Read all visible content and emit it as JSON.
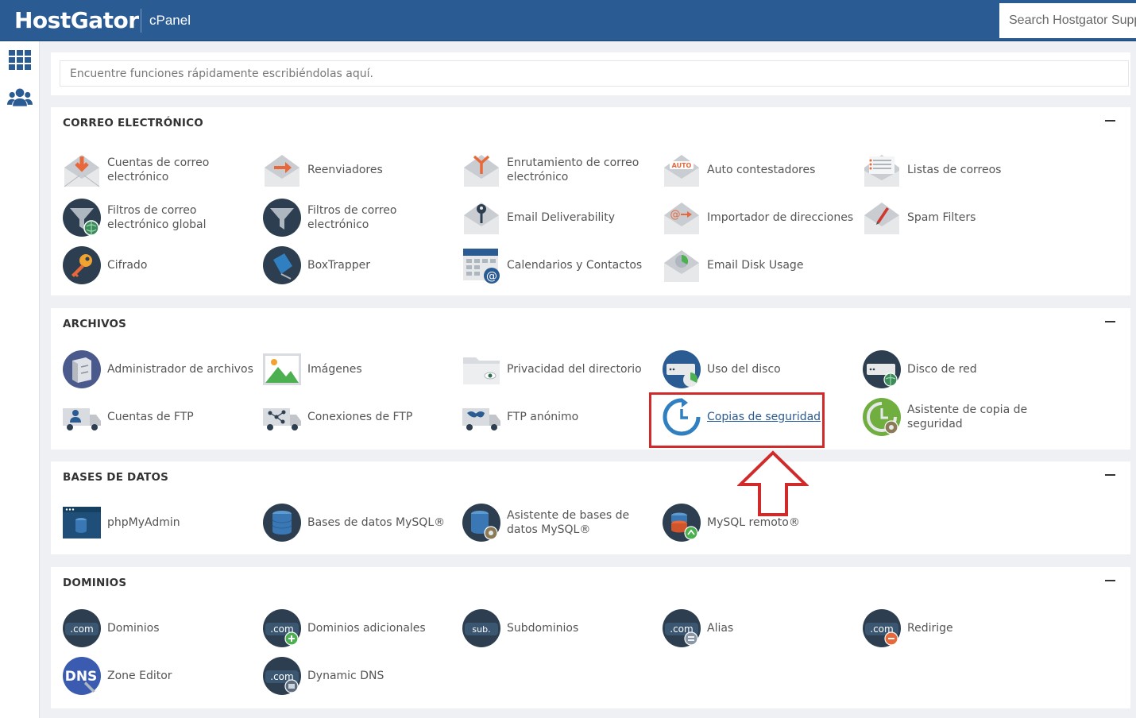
{
  "header": {
    "brand": "HostGator",
    "product": "cPanel",
    "search_placeholder": "Search Hostgator Support"
  },
  "sidebar": {
    "items": [
      {
        "icon": "grid-icon"
      },
      {
        "icon": "users-icon"
      }
    ]
  },
  "quick_search": {
    "placeholder": "Encuentre funciones rápidamente escribiéndolas aquí."
  },
  "sections": {
    "email": {
      "title": "CORREO ELECTRÓNICO",
      "items": [
        "Cuentas de correo electrónico",
        "Reenviadores",
        "Enrutamiento de correo electrónico",
        "Auto contestadores",
        "Listas de correos",
        "Filtros de correo electrónico global",
        "Filtros de correo electrónico",
        "Email Deliverability",
        "Importador de direcciones",
        "Spam Filters",
        "Cifrado",
        "BoxTrapper",
        "Calendarios y Contactos",
        "Email Disk Usage"
      ],
      "badges": {
        "auto": "AUTO"
      }
    },
    "files": {
      "title": "ARCHIVOS",
      "items": [
        "Administrador de archivos",
        "Imágenes",
        "Privacidad del directorio",
        "Uso del disco",
        "Disco de red",
        "Cuentas de FTP",
        "Conexiones de FTP",
        "FTP anónimo",
        "Copias de seguridad",
        "Asistente de copia de seguridad"
      ]
    },
    "databases": {
      "title": "BASES DE DATOS",
      "items": [
        "phpMyAdmin",
        "Bases de datos MySQL®",
        "Asistente de bases de datos MySQL®",
        "MySQL remoto®"
      ]
    },
    "domains": {
      "title": "DOMINIOS",
      "items": [
        "Dominios",
        "Dominios adicionales",
        "Subdominios",
        "Alias",
        "Redirige",
        "Zone Editor",
        "Dynamic DNS"
      ],
      "badges": {
        "com": ".com",
        "sub": "sub.",
        "dns": "DNS"
      }
    }
  },
  "colors": {
    "header_bg": "#2a5b93",
    "accent_blue": "#2a5b93",
    "annotation_red": "#d12a2a",
    "icon_dark": "#2c3e50"
  }
}
